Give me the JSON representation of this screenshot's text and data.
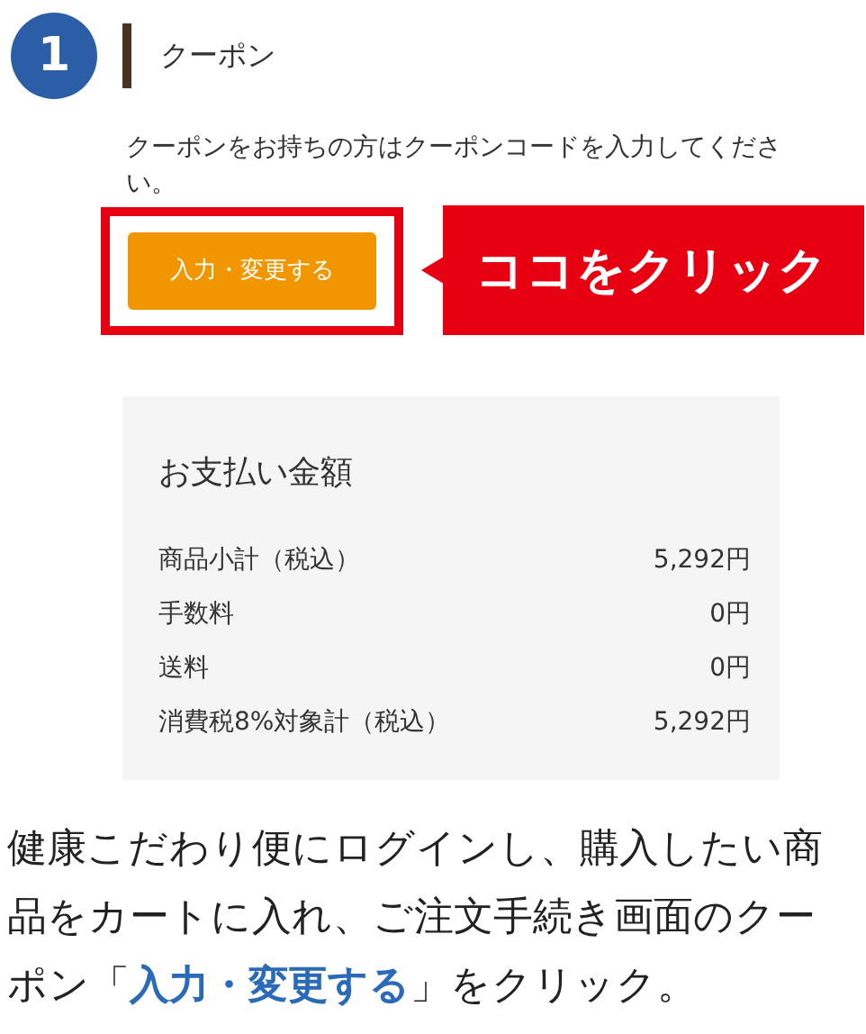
{
  "step": {
    "number": "1",
    "title": "クーポン"
  },
  "coupon": {
    "description": "クーポンをお持ちの方はクーポンコードを入力してください。",
    "button": "入力・変更する",
    "highlighted": true,
    "callout": "ココをクリック"
  },
  "payment": {
    "title": "お支払い金額",
    "rows": [
      {
        "label": "商品小計（税込）",
        "value": "5,292円"
      },
      {
        "label": "手数料",
        "value": "0円"
      },
      {
        "label": "送料",
        "value": "0円"
      },
      {
        "label": "消費税8%対象計（税込）",
        "value": "5,292円"
      }
    ]
  },
  "caption": "健康こだわり便にログインし、購入したい商品をカートに入れ、ご注文手続き画面のクーポン「**入力・変更する**」をクリック。"
}
